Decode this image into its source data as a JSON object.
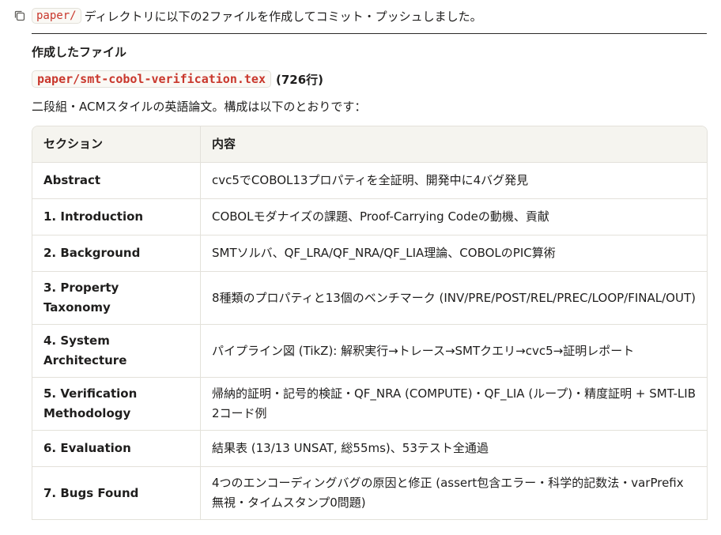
{
  "message": {
    "dir_code": "paper/",
    "text": "ディレクトリに以下の2ファイルを作成してコミット・プッシュしました。"
  },
  "section_heading": "作成したファイル",
  "file": {
    "name": "paper/smt-cobol-verification.tex",
    "lines": "(726行)"
  },
  "description": "二段組・ACMスタイルの英語論文。構成は以下のとおりです：",
  "table": {
    "headers": [
      "セクション",
      "内容"
    ],
    "rows": [
      {
        "section": "Abstract",
        "content": "cvc5でCOBOL13プロパティを全証明、開発中に4バグ発見"
      },
      {
        "section": "1. Introduction",
        "content": "COBOLモダナイズの課題、Proof-Carrying Codeの動機、貢献"
      },
      {
        "section": "2. Background",
        "content": "SMTソルバ、QF_LRA/QF_NRA/QF_LIA理論、COBOLのPIC算術"
      },
      {
        "section": "3. Property Taxonomy",
        "content": "8種類のプロパティと13個のベンチマーク (INV/PRE/POST/REL/PREC/LOOP/FINAL/OUT)"
      },
      {
        "section": "4. System Architecture",
        "content": "パイプライン図 (TikZ): 解釈実行→トレース→SMTクエリ→cvc5→証明レポート"
      },
      {
        "section": "5. Verification Methodology",
        "content": "帰納的証明・記号的検証・QF_NRA (COMPUTE)・QF_LIA (ループ)・精度証明 + SMT-LIB 2コード例"
      },
      {
        "section": "6. Evaluation",
        "content": "結果表 (13/13 UNSAT, 総55ms)、53テスト全通過"
      },
      {
        "section": "7. Bugs Found",
        "content": "4つのエンコーディングバグの原因と修正 (assert包含エラー・科学的記数法・varPrefix 無視・タイムスタンプ0問題)"
      }
    ]
  },
  "icons": {
    "copy": "copy-icon"
  },
  "colors": {
    "code_text": "#c9372c",
    "code_bg": "#faf9f5",
    "header_bg": "#f5f4ef",
    "border": "#e3e1da"
  }
}
